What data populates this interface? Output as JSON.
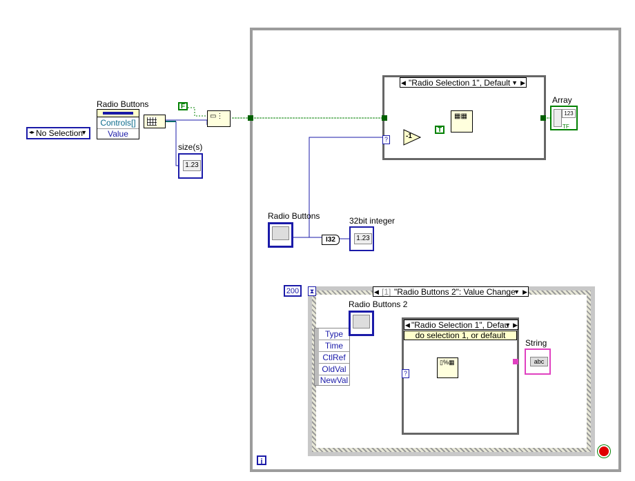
{
  "enum_control": {
    "value": "No Selection"
  },
  "property_node": {
    "label": "Radio Buttons",
    "rows": [
      "Controls[]",
      "Value"
    ]
  },
  "size_indicator": {
    "label": "size(s)",
    "display": "1.23"
  },
  "false_constant": "F",
  "true_constant": "T",
  "case_top": {
    "selector": "\"Radio Selection 1\", Default",
    "selector_terminal": "?"
  },
  "decrement": "-1",
  "array_indicator": {
    "label": "Array",
    "display": "123",
    "sub": "TF"
  },
  "radio_control_1": {
    "label": "Radio Buttons"
  },
  "to_i32": "I32",
  "int_indicator": {
    "label": "32bit integer",
    "display": "1.23"
  },
  "loop_timeout": "200",
  "event_selector": {
    "index": "[1]",
    "text": "\"Radio Buttons 2\": Value Change"
  },
  "radio_control_2": {
    "label": "Radio Buttons 2"
  },
  "event_data": [
    "Type",
    "Time",
    "CtlRef",
    "OldVal",
    "NewVal"
  ],
  "case_inner": {
    "selector": "\"Radio Selection 1\", Defau",
    "subdiagram_label": "do selection 1, or default",
    "selector_terminal": "?"
  },
  "string_indicator": {
    "label": "String",
    "display": "abc"
  },
  "loop_iteration": "i",
  "colors": {
    "int_wire": "#1a1aa8",
    "bool_wire": "#008000",
    "string_wire": "#e040c0",
    "structure": "#9c9c9c"
  }
}
